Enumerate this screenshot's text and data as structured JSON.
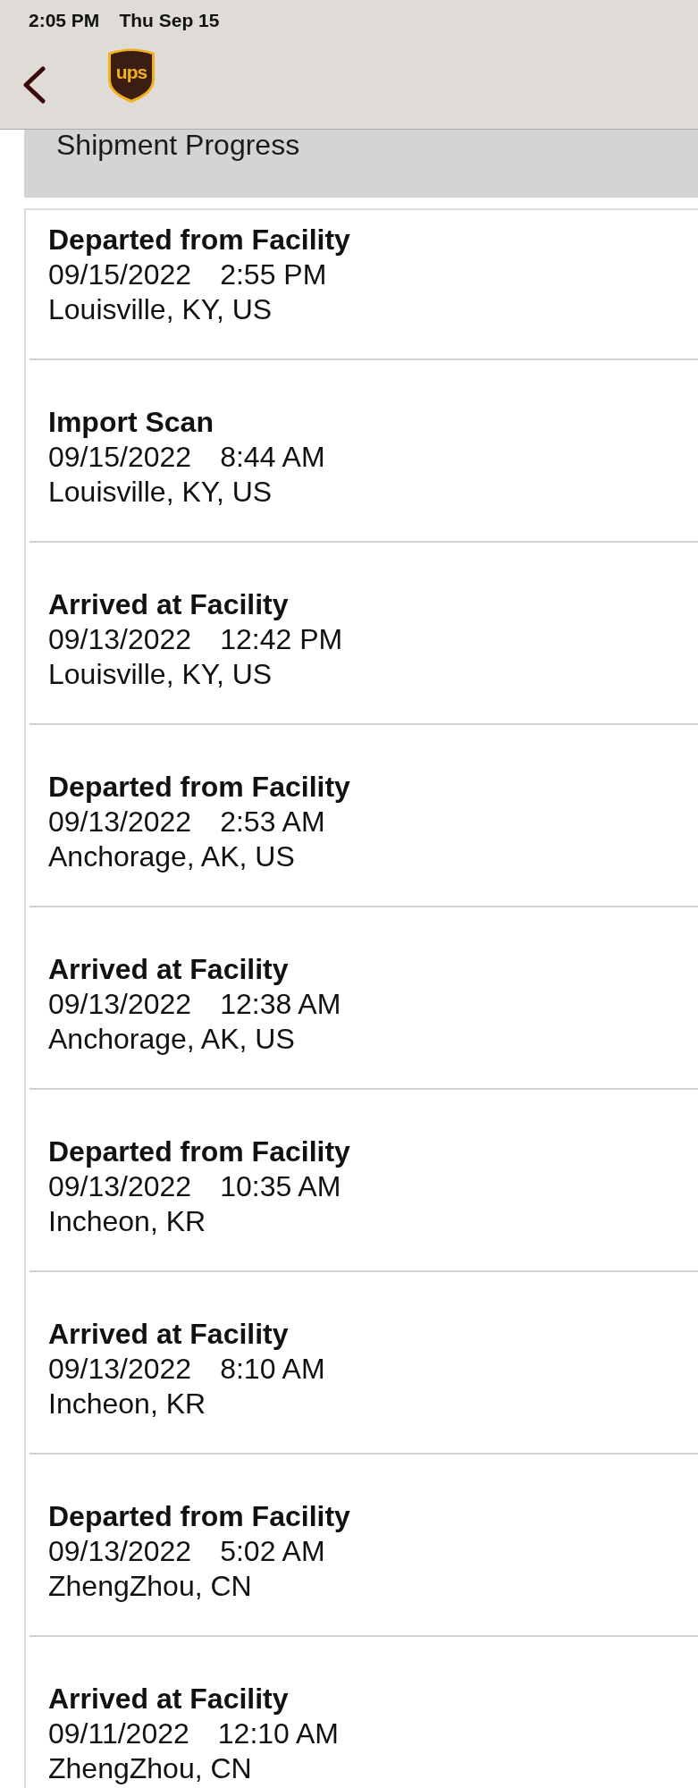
{
  "status_bar": {
    "time": "2:05 PM",
    "date": "Thu Sep 15"
  },
  "nav_bar": {
    "logo_text": "ups"
  },
  "section": {
    "title": "Shipment Progress"
  },
  "events": [
    {
      "status": "Departed from Facility",
      "date": "09/15/2022",
      "time": "2:55 PM",
      "location": "Louisville, KY, US"
    },
    {
      "status": "Import Scan",
      "date": "09/15/2022",
      "time": "8:44 AM",
      "location": "Louisville, KY, US"
    },
    {
      "status": "Arrived at Facility",
      "date": "09/13/2022",
      "time": "12:42 PM",
      "location": "Louisville, KY, US"
    },
    {
      "status": "Departed from Facility",
      "date": "09/13/2022",
      "time": "2:53 AM",
      "location": "Anchorage, AK, US"
    },
    {
      "status": "Arrived at Facility",
      "date": "09/13/2022",
      "time": "12:38 AM",
      "location": "Anchorage, AK, US"
    },
    {
      "status": "Departed from Facility",
      "date": "09/13/2022",
      "time": "10:35 AM",
      "location": "Incheon, KR"
    },
    {
      "status": "Arrived at Facility",
      "date": "09/13/2022",
      "time": "8:10 AM",
      "location": "Incheon, KR"
    },
    {
      "status": "Departed from Facility",
      "date": "09/13/2022",
      "time": "5:02 AM",
      "location": "ZhengZhou, CN"
    },
    {
      "status": "Arrived at Facility",
      "date": "09/11/2022",
      "time": "12:10 AM",
      "location": "ZhengZhou, CN"
    }
  ]
}
